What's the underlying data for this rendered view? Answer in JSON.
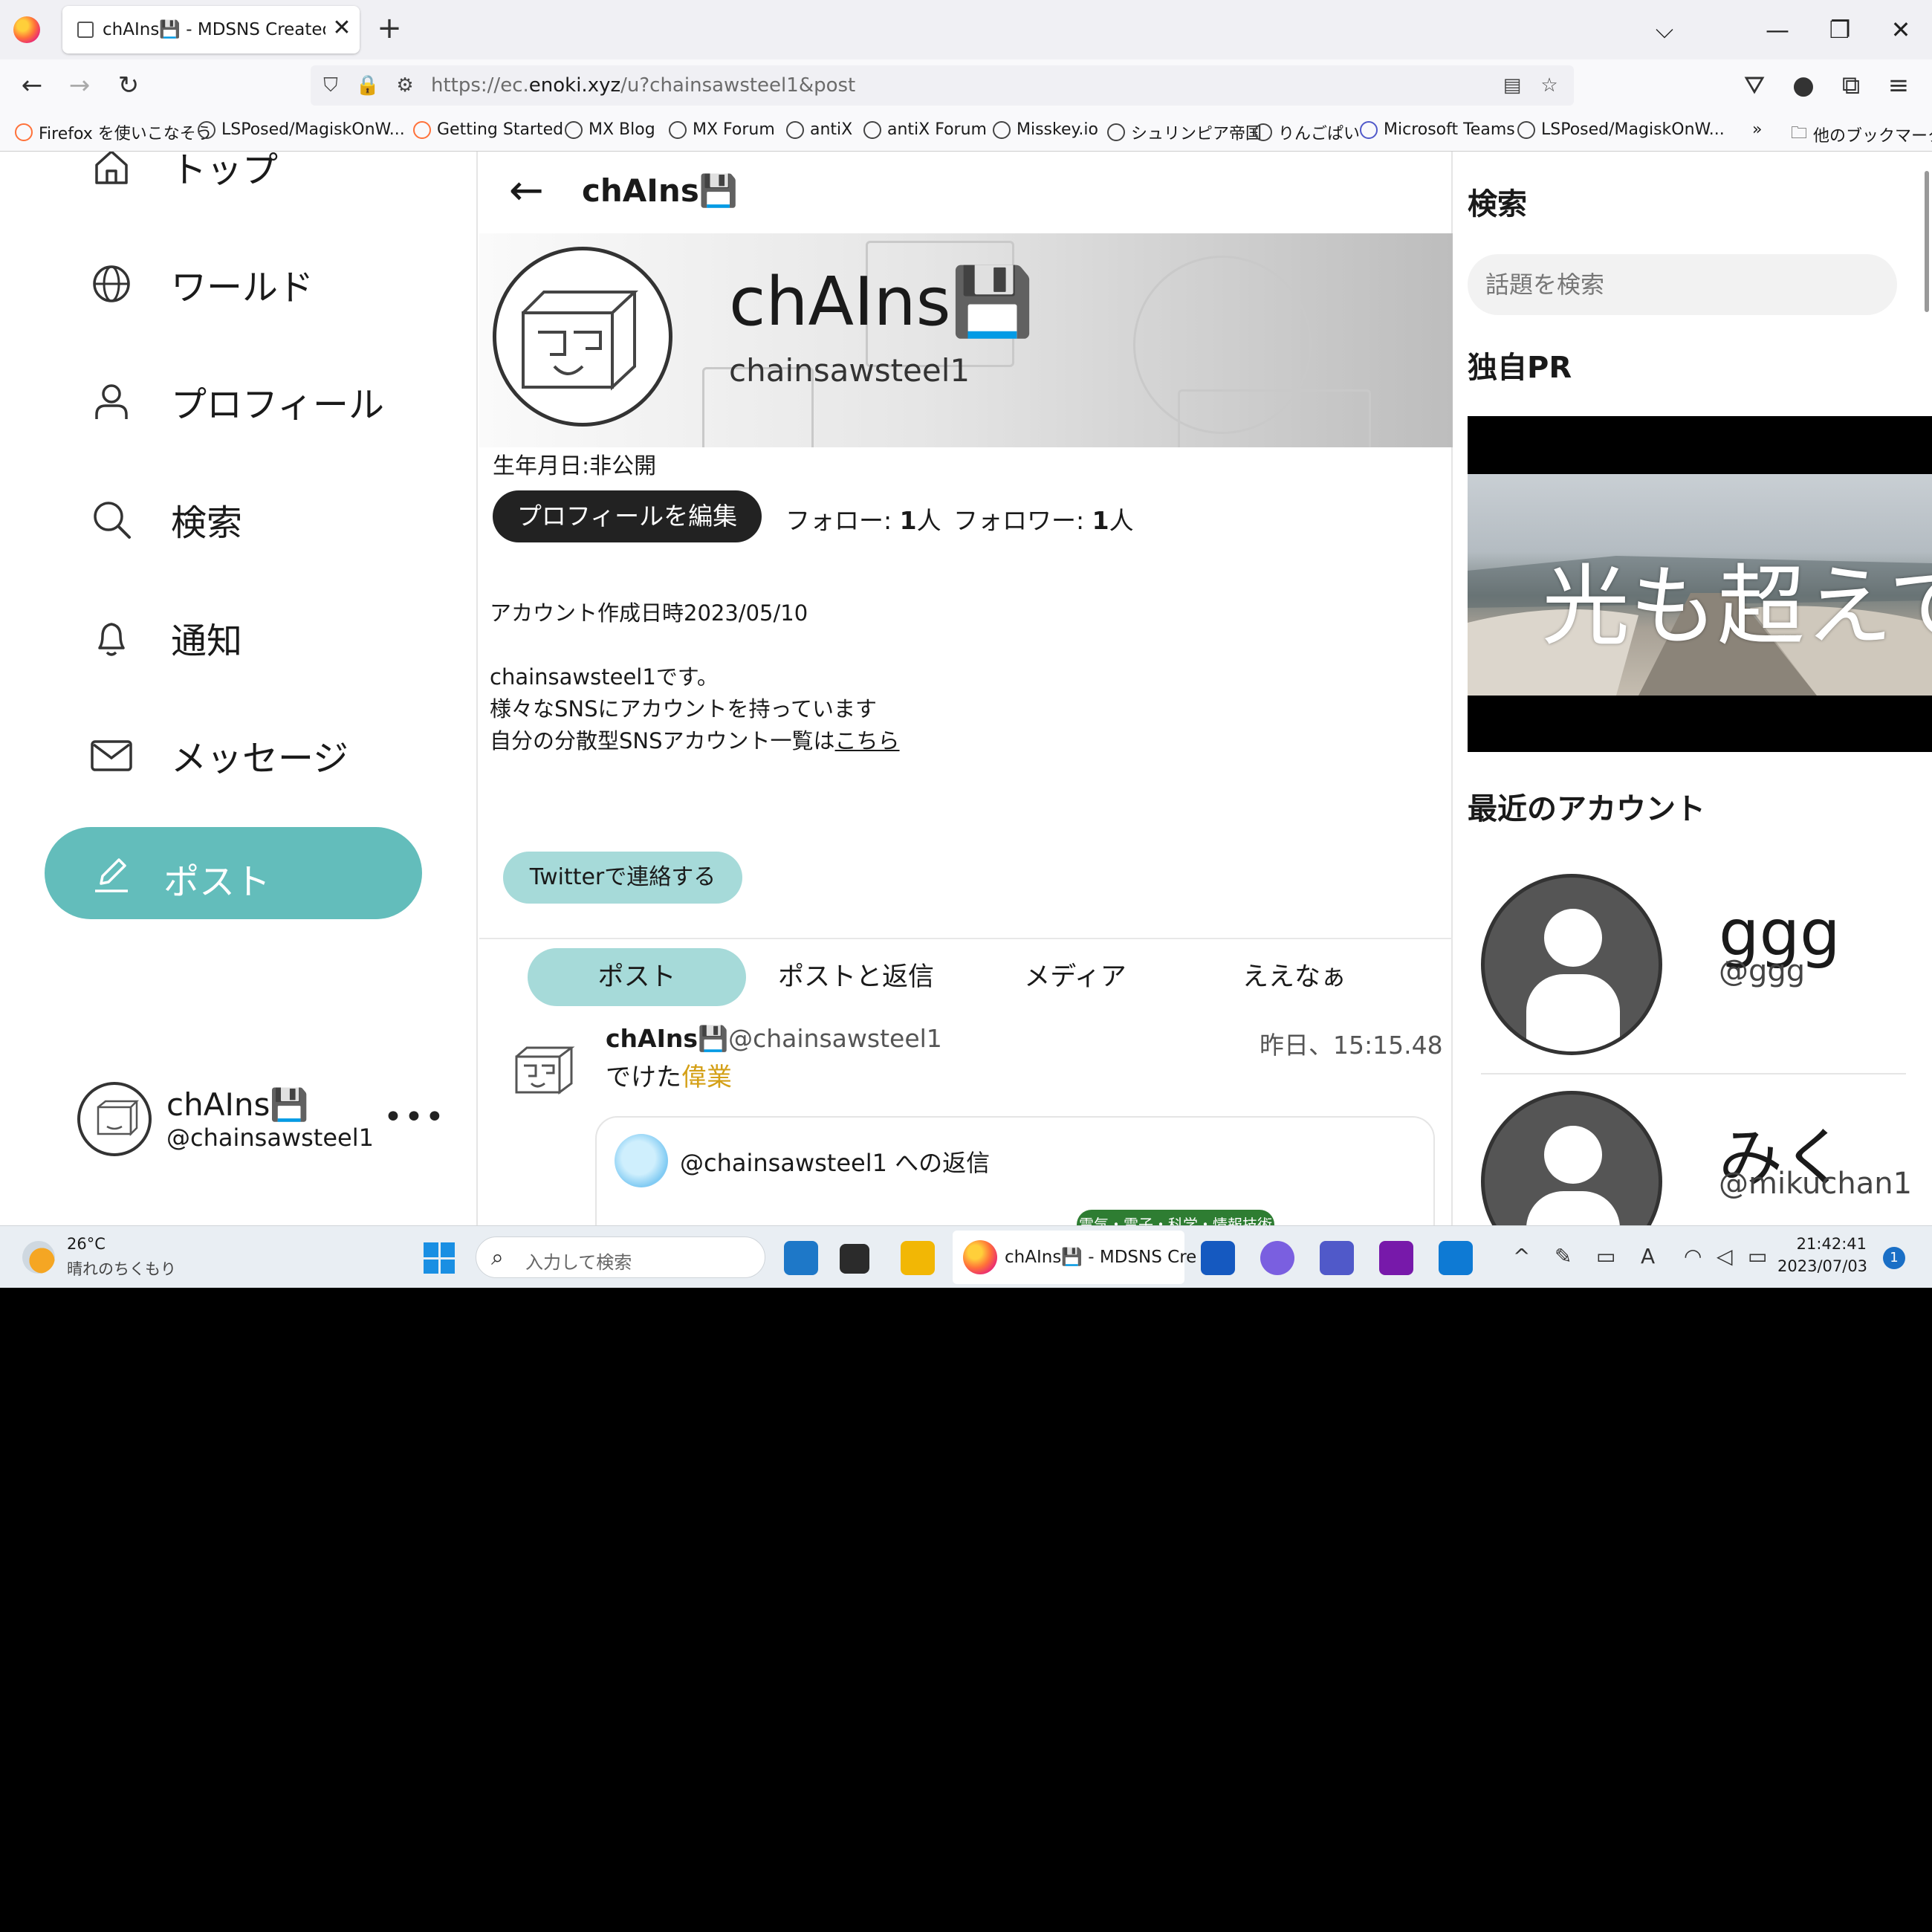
{
  "browser": {
    "tab_title": "chAIns💾 - MDSNS Created by",
    "tab_close": "✕",
    "new_tab": "+",
    "url_prefix": "https://ec.",
    "url_domain": "enoki.xyz",
    "url_path": "/u?chainsawsteel1&post",
    "bookmarks": [
      "Firefox を使いこなそう",
      "LSPosed/MagiskOnW...",
      "Getting Started",
      "MX Blog",
      "MX Forum",
      "antiX",
      "antiX Forum",
      "Misskey.io",
      "シュリンピア帝国",
      "りんごぱい",
      "Microsoft Teams",
      "LSPosed/MagiskOnW..."
    ],
    "other_bookmarks": "他のブックマーク"
  },
  "sidebar": {
    "items": [
      {
        "label": "トップ",
        "icon": "home-icon"
      },
      {
        "label": "ワールド",
        "icon": "globe-icon"
      },
      {
        "label": "プロフィール",
        "icon": "user-icon"
      },
      {
        "label": "検索",
        "icon": "search-icon"
      },
      {
        "label": "通知",
        "icon": "bell-icon"
      },
      {
        "label": "メッセージ",
        "icon": "mail-icon"
      }
    ],
    "post_button": "ポスト",
    "me": {
      "name": "chAIns💾",
      "handle": "@chainsawsteel1",
      "more": "•••"
    }
  },
  "profile": {
    "header_name": "chAIns💾",
    "name": "chAIns💾",
    "handle": "chainsawsteel1",
    "birth": "生年月日:非公開",
    "edit_button": "プロフィールを編集",
    "follow_label": "フォロー: ",
    "follow_count": "1",
    "follow_unit": "人",
    "follower_label": "フォロワー: ",
    "follower_count": "1",
    "follower_unit": "人",
    "bio": {
      "line1": "アカウント作成日時2023/05/10",
      "line2": "chainsawsteel1です。",
      "line3": "様々なSNSにアカウントを持っています",
      "line4_text": "自分の分散型SNSアカウント一覧は",
      "line4_link": "こちら"
    },
    "twitter_button": "Twitterで連絡する",
    "tabs": [
      "ポスト",
      "ポストと返信",
      "メディア",
      "ええなぁ"
    ]
  },
  "post": {
    "name": "chAIns💾",
    "handle": "@chainsawsteel1",
    "time": "昨日、15:15.48",
    "text": "でけた",
    "text_accent": "偉業",
    "reply_to": "@chainsawsteel1 への返信",
    "chip": "電気・電子・科学・情報技術"
  },
  "right": {
    "search_heading": "検索",
    "search_placeholder": "話題を検索",
    "pr_heading": "独自PR",
    "pr_text": "光も超えて",
    "recent_heading": "最近のアカウント",
    "accounts": [
      {
        "name": "ggg",
        "handle": "@ggg"
      },
      {
        "name": "みく",
        "handle": "@mikuchan1"
      }
    ]
  },
  "taskbar": {
    "temp": "26°C",
    "weather": "晴れのちくもり",
    "search_placeholder": "入力して検索",
    "active_app": "chAIns💾 - MDSNS Cre",
    "time": "21:42:41",
    "date": "2023/07/03",
    "notifications": "1"
  },
  "colors": {
    "accent": "#63bdbb",
    "accent_light": "#a6dad9"
  }
}
